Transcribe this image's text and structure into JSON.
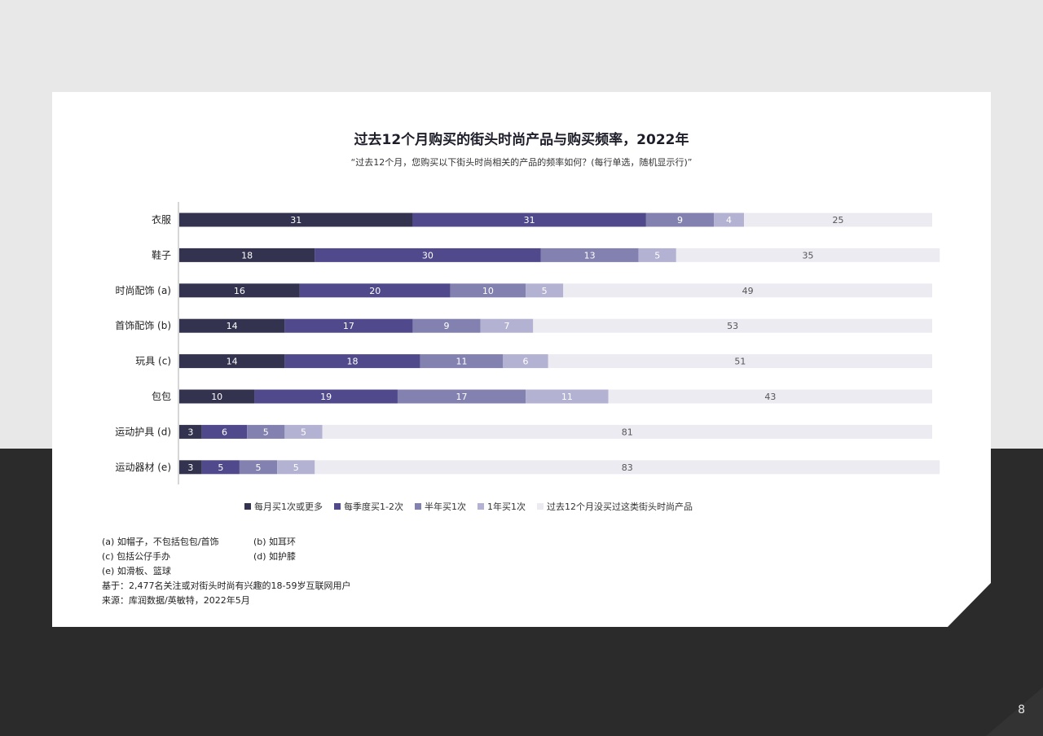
{
  "page": {
    "number": "8"
  },
  "chart_data": {
    "type": "bar",
    "orientation": "horizontal",
    "stacked": true,
    "title": "过去12个月购买的街头时尚产品与购买频率，2022年",
    "subtitle": "“过去12个月，您购买以下街头时尚相关的产品的频率如何？(每行单选，随机显示行)”",
    "categories": [
      "衣服",
      "鞋子",
      "时尚配饰 (a)",
      "首饰配饰 (b)",
      "玩具 (c)",
      "包包",
      "运动护具 (d)",
      "运动器材 (e)"
    ],
    "series": [
      {
        "name": "每月买1次或更多",
        "color": "#33334f",
        "label_color": "#ffffff",
        "values": [
          31,
          18,
          16,
          14,
          14,
          10,
          3,
          3
        ]
      },
      {
        "name": "每季度买1-2次",
        "color": "#504a8c",
        "label_color": "#ffffff",
        "values": [
          31,
          30,
          20,
          17,
          18,
          19,
          6,
          5
        ]
      },
      {
        "name": "半年买1次",
        "color": "#8381b0",
        "label_color": "#ffffff",
        "values": [
          9,
          13,
          10,
          9,
          11,
          17,
          5,
          5
        ]
      },
      {
        "name": "1年买1次",
        "color": "#b4b2d2",
        "label_color": "#ffffff",
        "values": [
          4,
          5,
          5,
          7,
          6,
          11,
          5,
          5
        ]
      },
      {
        "name": "过去12个月没买过这类街头时尚产品",
        "color": "#ecebf2",
        "label_color": "#555555",
        "values": [
          25,
          35,
          49,
          53,
          51,
          43,
          81,
          83
        ]
      }
    ],
    "xlim": [
      0,
      100
    ],
    "legend_position": "bottom"
  },
  "notes": {
    "a": "(a) 如帽子，不包括包包/首饰",
    "b": "(b) 如耳环",
    "c": "(c) 包括公仔手办",
    "d": "(d) 如护膝",
    "e": "(e) 如滑板、篮球",
    "base": "基于：2,477名关注或对街头时尚有兴趣的18-59岁互联网用户",
    "source": "来源：库润数据/英敏特，2022年5月"
  }
}
